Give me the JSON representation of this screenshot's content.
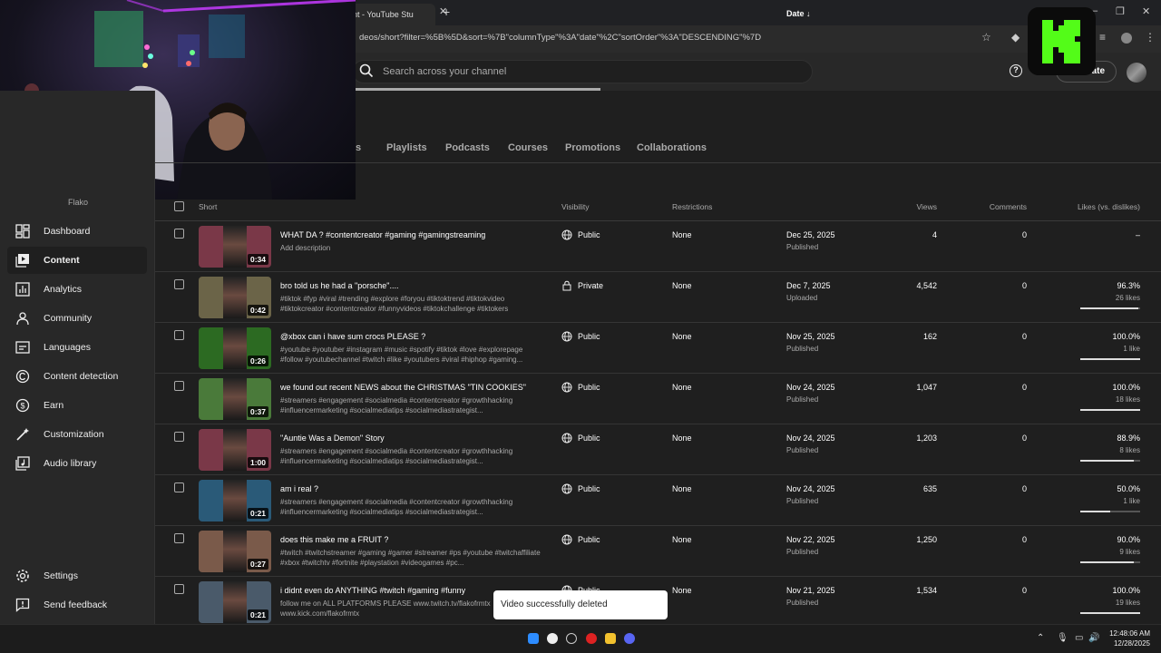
{
  "browser": {
    "tab_title": "ent - YouTube Stu",
    "url": "deos/short?filter=%5B%5D&sort=%7B\"columnType\"%3A\"date\"%2C\"sortOrder\"%3A\"DESCENDING\"%7D"
  },
  "header": {
    "search_placeholder": "Search across your channel",
    "create_label": "eate"
  },
  "sidebar": {
    "channel_name": "Flako",
    "items": [
      {
        "label": "Dashboard",
        "icon": "dashboard-icon"
      },
      {
        "label": "Content",
        "icon": "content-icon",
        "active": true
      },
      {
        "label": "Analytics",
        "icon": "analytics-icon"
      },
      {
        "label": "Community",
        "icon": "community-icon"
      },
      {
        "label": "Languages",
        "icon": "languages-icon"
      },
      {
        "label": "Content detection",
        "icon": "copyright-icon"
      },
      {
        "label": "Earn",
        "icon": "earn-icon"
      },
      {
        "label": "Customization",
        "icon": "customization-icon"
      },
      {
        "label": "Audio library",
        "icon": "audio-library-icon"
      }
    ],
    "settings_label": "Settings",
    "feedback_label": "Send feedback"
  },
  "content_tabs": [
    "s",
    "Playlists",
    "Podcasts",
    "Courses",
    "Promotions",
    "Collaborations"
  ],
  "table": {
    "headers": {
      "short": "Short",
      "visibility": "Visibility",
      "restrictions": "Restrictions",
      "date": "Date",
      "views": "Views",
      "comments": "Comments",
      "likes": "Likes (vs. dislikes)"
    },
    "rows": [
      {
        "title": "WHAT DA ? #contentcreator #gaming #gamingstreaming",
        "desc": "Add description",
        "duration": "0:34",
        "visibility": "Public",
        "restrictions": "None",
        "date": "Dec 25, 2025",
        "status": "Published",
        "views": "4",
        "comments": "0",
        "likes": "–",
        "likes_count": "",
        "like_ratio": null,
        "thumb_bg": "#7a3848"
      },
      {
        "title": "bro told us he had a \"porsche\"....",
        "desc": "#tiktok #fyp #viral #trending #explore #foryou #tiktoktrend #tiktokvideo #tiktokcreator #contentcreator #funnyvideos #tiktokchallenge #tiktokers",
        "duration": "0:42",
        "visibility": "Private",
        "restrictions": "None",
        "date": "Dec 7, 2025",
        "status": "Uploaded",
        "views": "4,542",
        "comments": "0",
        "likes": "96.3%",
        "likes_count": "26 likes",
        "like_ratio": 0.963,
        "thumb_bg": "#6b6448"
      },
      {
        "title": "@xbox can i have sum crocs PLEASE ?",
        "desc": "#youtube #youtuber #instagram #music #spotify #tiktok #love #explorepage #follow #youtubechannel #twitch #like #youtubers #viral #hiphop #gaming...",
        "duration": "0:26",
        "visibility": "Public",
        "restrictions": "None",
        "date": "Nov 25, 2025",
        "status": "Published",
        "views": "162",
        "comments": "0",
        "likes": "100.0%",
        "likes_count": "1 like",
        "like_ratio": 1.0,
        "thumb_bg": "#2c6a22"
      },
      {
        "title": "we found out recent NEWS about the CHRISTMAS \"TIN COOKIES\"",
        "desc": "#streamers #engagement #socialmedia #contentcreator #growthhacking #influencermarketing #socialmediatips #socialmediastrategist...",
        "duration": "0:37",
        "visibility": "Public",
        "restrictions": "None",
        "date": "Nov 24, 2025",
        "status": "Published",
        "views": "1,047",
        "comments": "0",
        "likes": "100.0%",
        "likes_count": "18 likes",
        "like_ratio": 1.0,
        "thumb_bg": "#4a7a3a"
      },
      {
        "title": "\"Auntie Was a Demon\" Story",
        "desc": "#streamers #engagement #socialmedia #contentcreator #growthhacking #influencermarketing #socialmediatips #socialmediastrategist...",
        "duration": "1:00",
        "visibility": "Public",
        "restrictions": "None",
        "date": "Nov 24, 2025",
        "status": "Published",
        "views": "1,203",
        "comments": "0",
        "likes": "88.9%",
        "likes_count": "8 likes",
        "like_ratio": 0.889,
        "thumb_bg": "#7a3848"
      },
      {
        "title": "am i real ?",
        "desc": "#streamers #engagement #socialmedia #contentcreator #growthhacking #influencermarketing #socialmediatips #socialmediastrategist...",
        "duration": "0:21",
        "visibility": "Public",
        "restrictions": "None",
        "date": "Nov 24, 2025",
        "status": "Published",
        "views": "635",
        "comments": "0",
        "likes": "50.0%",
        "likes_count": "1 like",
        "like_ratio": 0.5,
        "thumb_bg": "#2a5a78"
      },
      {
        "title": "does this make me a FRUIT ?",
        "desc": "#twitch #twitchstreamer #gaming #gamer #streamer #ps #youtube #twitchaffiliate #xbox #twitchtv #fortnite #playstation #videogames #pc...",
        "duration": "0:27",
        "visibility": "Public",
        "restrictions": "None",
        "date": "Nov 22, 2025",
        "status": "Published",
        "views": "1,250",
        "comments": "0",
        "likes": "90.0%",
        "likes_count": "9 likes",
        "like_ratio": 0.9,
        "thumb_bg": "#7a5a4a"
      },
      {
        "title": "i didnt even do ANYTHING #twitch #gaming #funny",
        "desc": "follow me on ALL PLATFORMS PLEASE www.twitch.tv/flakofrmtx www.kick.com/flakofrmtx",
        "duration": "0:21",
        "visibility": "Public",
        "restrictions": "None",
        "date": "Nov 21, 2025",
        "status": "Published",
        "views": "1,534",
        "comments": "0",
        "likes": "100.0%",
        "likes_count": "19 likes",
        "like_ratio": 1.0,
        "thumb_bg": "#4a5a6a"
      }
    ]
  },
  "toast": "Video successfully deleted",
  "taskbar": {
    "time": "12:48:06 AM",
    "date": "12/28/2025"
  },
  "colors": {
    "background": "#1f1f1f",
    "sidebar": "#282828",
    "kick_green": "#53fc18"
  }
}
